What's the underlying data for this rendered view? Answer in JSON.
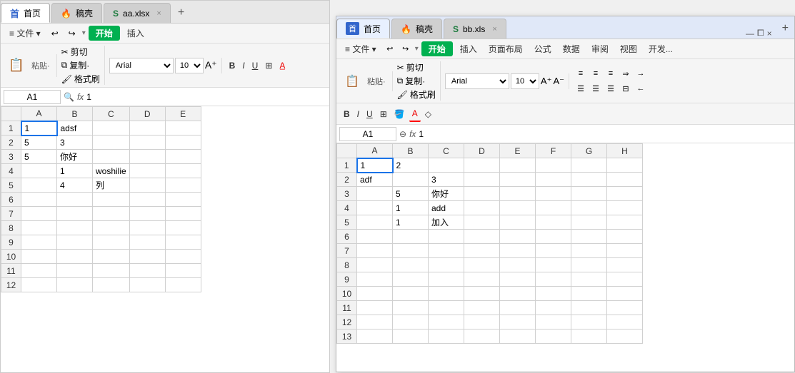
{
  "leftWindow": {
    "tabs": [
      {
        "label": "首页",
        "icon": "home",
        "active": true
      },
      {
        "label": "稿壳",
        "icon": "wps",
        "active": false
      },
      {
        "label": "aa.xlsx",
        "icon": "xlsx",
        "active": false
      }
    ],
    "menuBar": {
      "items": [
        "≡ 文件 ▾",
        "插入"
      ]
    },
    "btnStart": "开始",
    "toolbar": {
      "pasteLabel": "粘贴·",
      "cutLabel": "✂ 剪切",
      "copyLabel": "□ 复制·",
      "formatLabel": "格式刷",
      "fontName": "Arial",
      "fontSize": "10",
      "boldLabel": "B",
      "italicLabel": "I",
      "underlineLabel": "U"
    },
    "formulaBar": {
      "cellRef": "A1",
      "formula": "1"
    },
    "columns": [
      "A",
      "B",
      "C",
      "D",
      "E"
    ],
    "rows": [
      {
        "id": 1,
        "cells": [
          "1",
          "adsf",
          "",
          "",
          ""
        ]
      },
      {
        "id": 2,
        "cells": [
          "5",
          "3",
          "",
          "",
          ""
        ]
      },
      {
        "id": 3,
        "cells": [
          "5",
          "你好",
          "",
          "",
          ""
        ]
      },
      {
        "id": 4,
        "cells": [
          "",
          "1",
          "woshilie",
          "",
          ""
        ]
      },
      {
        "id": 5,
        "cells": [
          "",
          "4",
          "列",
          "",
          ""
        ]
      },
      {
        "id": 6,
        "cells": [
          "",
          "",
          "",
          "",
          ""
        ]
      },
      {
        "id": 7,
        "cells": [
          "",
          "",
          "",
          "",
          ""
        ]
      },
      {
        "id": 8,
        "cells": [
          "",
          "",
          "",
          "",
          ""
        ]
      },
      {
        "id": 9,
        "cells": [
          "",
          "",
          "",
          "",
          ""
        ]
      },
      {
        "id": 10,
        "cells": [
          "",
          "",
          "",
          "",
          ""
        ]
      },
      {
        "id": 11,
        "cells": [
          "",
          "",
          "",
          "",
          ""
        ]
      },
      {
        "id": 12,
        "cells": [
          "",
          "",
          "",
          "",
          ""
        ]
      }
    ]
  },
  "rightWindow": {
    "tabs": [
      {
        "label": "首页",
        "icon": "home",
        "active": true
      },
      {
        "label": "稿壳",
        "icon": "wps",
        "active": false
      },
      {
        "label": "bb.xls",
        "icon": "xlsx",
        "active": false
      }
    ],
    "menuBar": {
      "items": [
        "≡ 文件 ▾",
        "插入",
        "页面布局",
        "公式",
        "数据",
        "审阅",
        "视图",
        "开发..."
      ]
    },
    "btnStart": "开始",
    "toolbar": {
      "pasteLabel": "粘贴·",
      "cutLabel": "✂ 剪切",
      "copyLabel": "□ 复制·",
      "formatLabel": "格式刷",
      "fontName": "Arial",
      "fontSize": "10",
      "boldLabel": "B",
      "italicLabel": "I",
      "underlineLabel": "U"
    },
    "formulaBar": {
      "cellRef": "A1",
      "formula": "1"
    },
    "columns": [
      "A",
      "B",
      "C",
      "D",
      "E",
      "F",
      "G",
      "H"
    ],
    "rows": [
      {
        "id": 1,
        "cells": [
          "1",
          "2",
          "",
          "",
          "",
          "",
          "",
          ""
        ]
      },
      {
        "id": 2,
        "cells": [
          "adf",
          "",
          "3",
          "",
          "",
          "",
          "",
          ""
        ]
      },
      {
        "id": 3,
        "cells": [
          "",
          "5",
          "你好",
          "",
          "",
          "",
          "",
          ""
        ]
      },
      {
        "id": 4,
        "cells": [
          "",
          "1",
          "add",
          "",
          "",
          "",
          "",
          ""
        ]
      },
      {
        "id": 5,
        "cells": [
          "",
          "1",
          "加入",
          "",
          "",
          "",
          "",
          ""
        ]
      },
      {
        "id": 6,
        "cells": [
          "",
          "",
          "",
          "",
          "",
          "",
          "",
          ""
        ]
      },
      {
        "id": 7,
        "cells": [
          "",
          "",
          "",
          "",
          "",
          "",
          "",
          ""
        ]
      },
      {
        "id": 8,
        "cells": [
          "",
          "",
          "",
          "",
          "",
          "",
          "",
          ""
        ]
      },
      {
        "id": 9,
        "cells": [
          "",
          "",
          "",
          "",
          "",
          "",
          "",
          ""
        ]
      },
      {
        "id": 10,
        "cells": [
          "",
          "",
          "",
          "",
          "",
          "",
          "",
          ""
        ]
      },
      {
        "id": 11,
        "cells": [
          "",
          "",
          "",
          "",
          "",
          "",
          "",
          ""
        ]
      },
      {
        "id": 12,
        "cells": [
          "",
          "",
          "",
          "",
          "",
          "",
          "",
          ""
        ]
      },
      {
        "id": 13,
        "cells": [
          "",
          "",
          "",
          "",
          "",
          "",
          "",
          ""
        ]
      }
    ]
  },
  "icons": {
    "home": "首",
    "wps": "🔥",
    "xlsx": "S",
    "cut": "✂",
    "copy": "⧉",
    "paste": "📋",
    "undo": "↩",
    "redo": "↪",
    "search": "🔍",
    "fx": "fx",
    "minus": "⊖",
    "close": "×",
    "minimize": "—",
    "restore": "⧠",
    "add": "+"
  }
}
